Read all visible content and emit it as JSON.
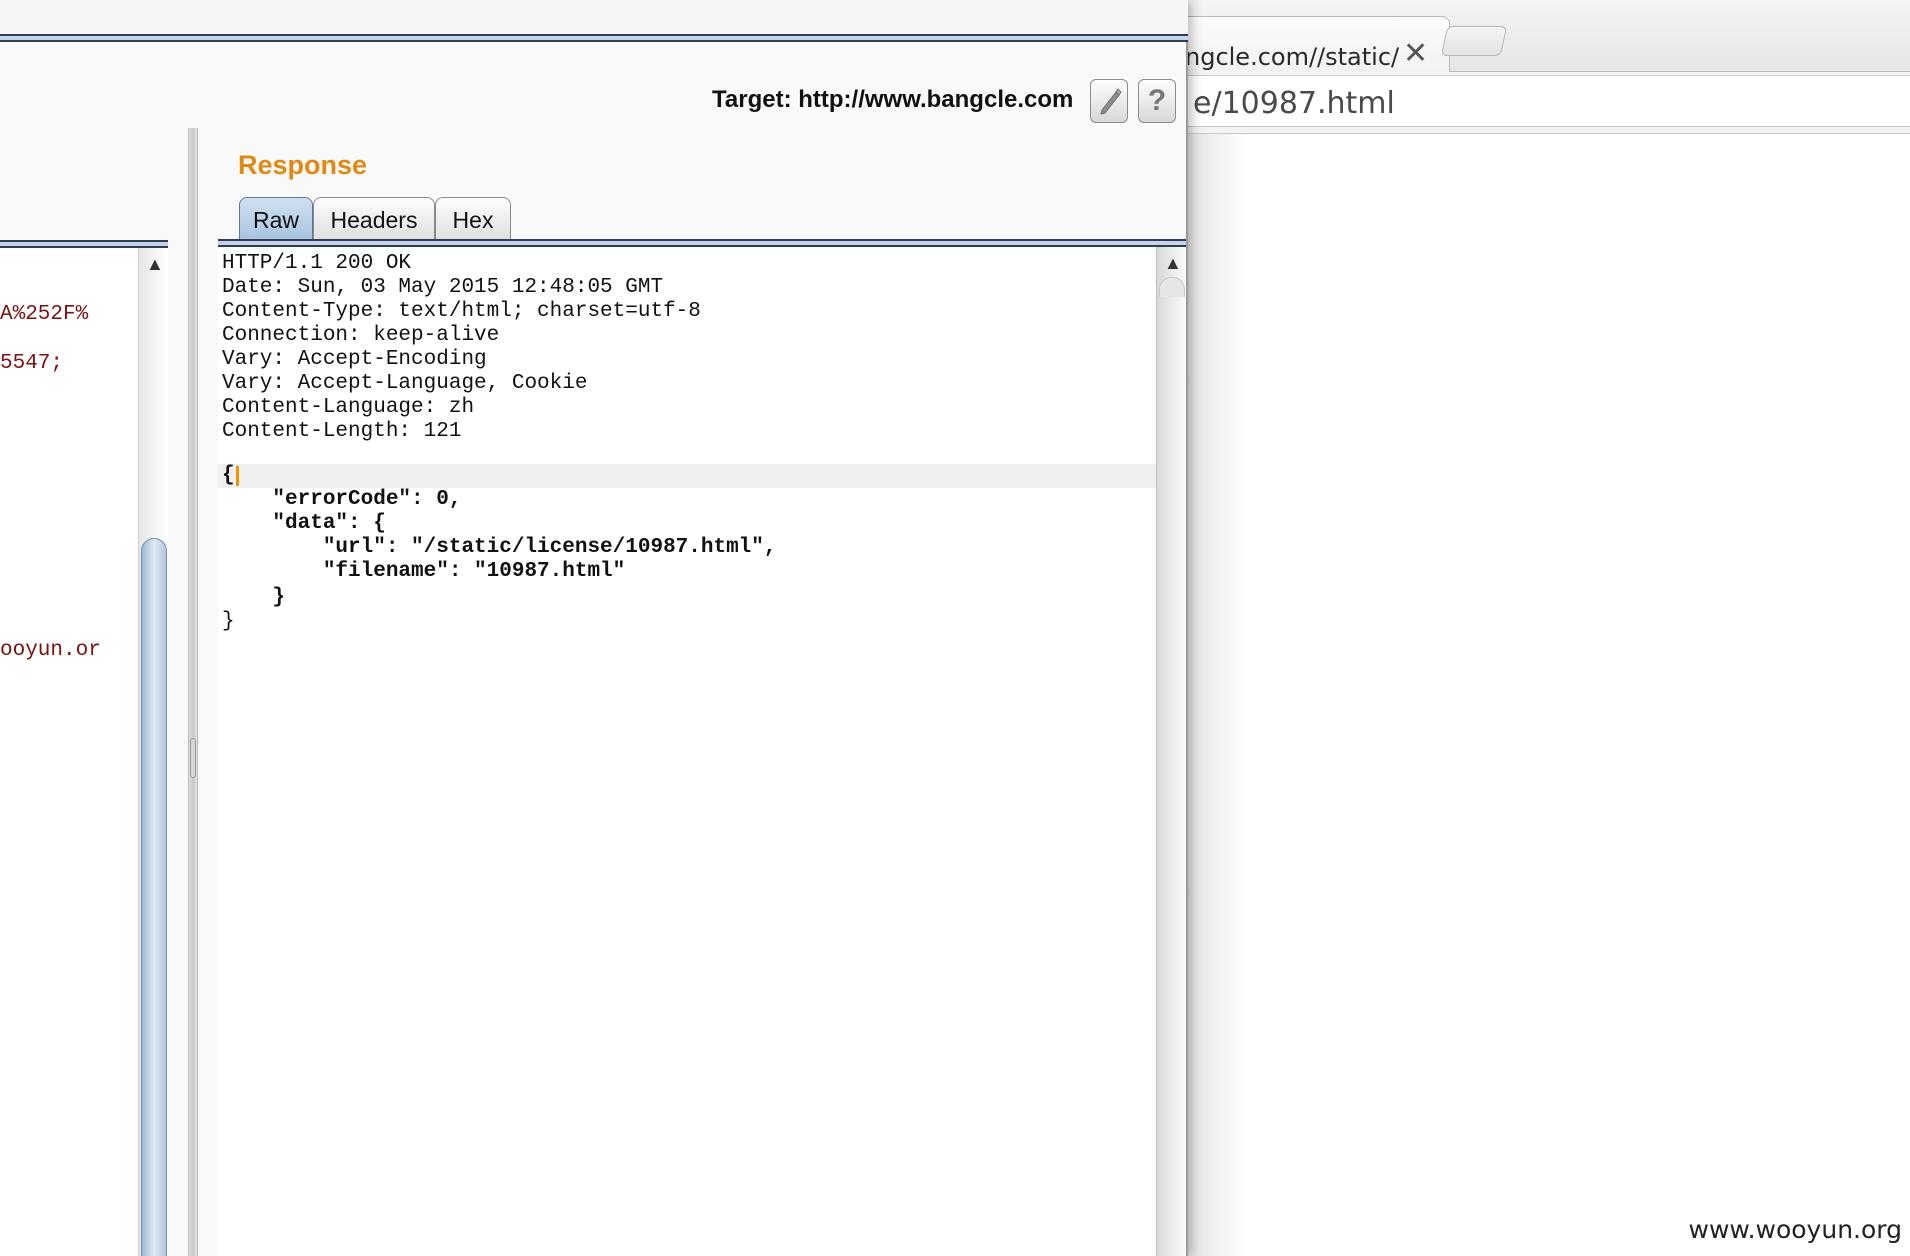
{
  "browser": {
    "tab_title": "ngcle.com//static/",
    "tab_close": "✕",
    "url": "e/10987.html"
  },
  "watermark": "www.wooyun.org",
  "burp": {
    "target_label": "Target: http://www.bangcle.com",
    "edit_icon": "pencil-icon",
    "help_label": "?",
    "request_fragments": [
      "A%252F%",
      "5547;",
      "ooyun.or"
    ],
    "response": {
      "title": "Response",
      "tabs": [
        "Raw",
        "Headers",
        "Hex"
      ],
      "active_tab": "Raw",
      "headers": [
        "HTTP/1.1 200 OK",
        "Date: Sun, 03 May 2015 12:48:05 GMT",
        "Content-Type: text/html; charset=utf-8",
        "Connection: keep-alive",
        "Vary: Accept-Encoding",
        "Vary: Accept-Language, Cookie",
        "Content-Language: zh",
        "Content-Length: 121"
      ],
      "body": [
        "{",
        "    \"errorCode\": 0,",
        "    \"data\": {",
        "        \"url\": \"/static/license/10987.html\",",
        "        \"filename\": \"10987.html\"",
        "    }",
        "}"
      ]
    }
  },
  "colors": {
    "response_title": "#e08a16",
    "request_text": "#7a1212",
    "caret": "#f29400",
    "active_tab": "#a8c3e0"
  }
}
